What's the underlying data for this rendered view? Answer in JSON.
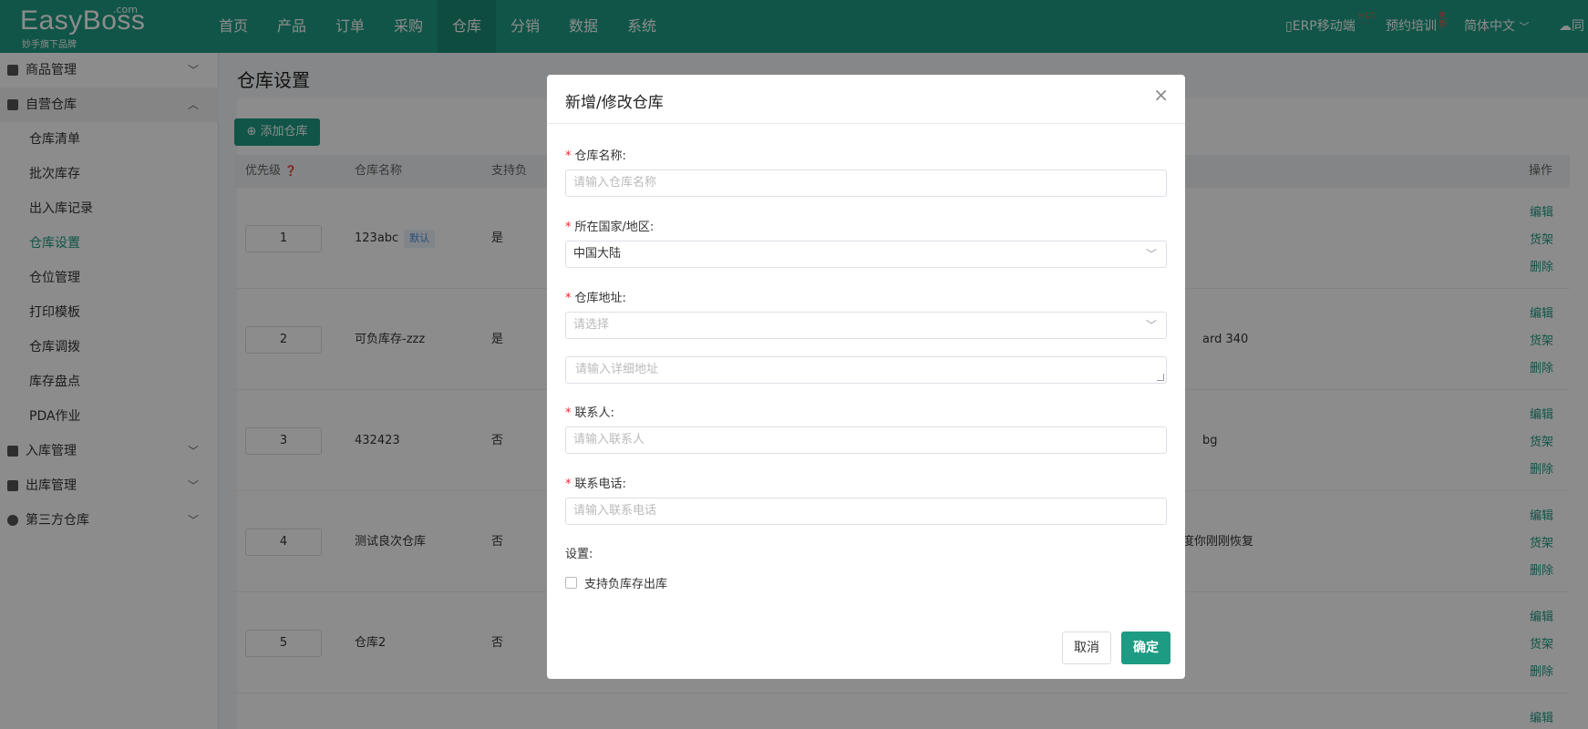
{
  "header": {
    "logo_text": "EasyBoss",
    "logo_com": ".com",
    "logo_sub": "妙手旗下品牌",
    "nav": [
      "首页",
      "产品",
      "订单",
      "采购",
      "仓库",
      "分销",
      "数据",
      "系统"
    ],
    "active_nav": "仓库",
    "erp_mobile": "ERP移动端",
    "erp_badge": "HOT",
    "training": "预约培训",
    "training_badge": "免费",
    "language": "简体中文",
    "cloud_label": "同"
  },
  "sidebar": {
    "groups": [
      {
        "label": "商品管理",
        "icon": "goods-icon"
      },
      {
        "label": "自营仓库",
        "icon": "warehouse-icon"
      },
      {
        "label": "入库管理",
        "icon": "inbound-icon"
      },
      {
        "label": "出库管理",
        "icon": "outbound-icon"
      },
      {
        "label": "第三方仓库",
        "icon": "third-party-icon"
      }
    ],
    "items": [
      "仓库清单",
      "批次库存",
      "出入库记录",
      "仓库设置",
      "仓位管理",
      "打印模板",
      "仓库调拨",
      "库存盘点",
      "PDA作业"
    ],
    "active_item": "仓库设置"
  },
  "main": {
    "title": "仓库设置",
    "add_button": "添加仓库",
    "columns": {
      "priority": "优先级",
      "name": "仓库名称",
      "negative": "支持负",
      "address_tail": "",
      "ops": "操作"
    },
    "rows": [
      {
        "priority": "1",
        "name": "123abc",
        "tag": "默认",
        "negative": "是",
        "address_tail": ""
      },
      {
        "priority": "2",
        "name": "可负库存-zzz",
        "tag": "",
        "negative": "是",
        "address_tail": "ard 340"
      },
      {
        "priority": "3",
        "name": "432423",
        "tag": "",
        "negative": "否",
        "address_tail": "bg"
      },
      {
        "priority": "4",
        "name": "测试良次仓库",
        "tag": "",
        "negative": "否",
        "address_tail": "度你刚刚恢复"
      },
      {
        "priority": "5",
        "name": "仓库2",
        "tag": "",
        "negative": "否",
        "address_tail": ""
      }
    ],
    "ops": {
      "edit": "编辑",
      "shelf": "货架",
      "delete": "删除"
    }
  },
  "modal": {
    "title": "新增/修改仓库",
    "close": "×",
    "name_label": "仓库名称:",
    "name_placeholder": "请输入仓库名称",
    "country_label": "所在国家/地区:",
    "country_value": "中国大陆",
    "address_label": "仓库地址:",
    "address_select_placeholder": "请选择",
    "address_detail_placeholder": "请输入详细地址",
    "contact_label": "联系人:",
    "contact_placeholder": "请输入联系人",
    "phone_label": "联系电话:",
    "phone_placeholder": "请输入联系电话",
    "settings_label": "设置:",
    "negative_checkbox_label": "支持负库存出库",
    "cancel": "取消",
    "confirm": "确定"
  },
  "colors": {
    "brand": "#1e9b83",
    "required": "#f5222d"
  }
}
